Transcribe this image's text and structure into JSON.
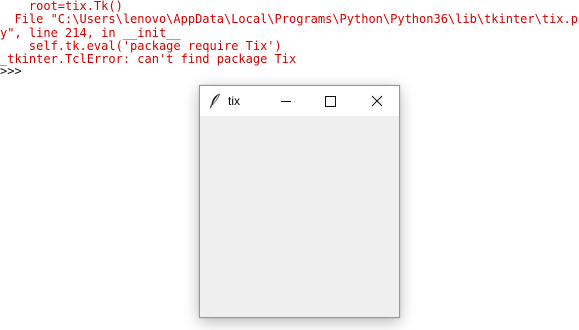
{
  "console": {
    "lines": [
      "    root=tix.Tk()",
      "  File \"C:\\Users\\lenovo\\AppData\\Local\\Programs\\Python\\Python36\\lib\\tkinter\\tix.p",
      "y\", line 214, in __init__",
      "    self.tk.eval('package require Tix')",
      "_tkinter.TclError: can't find package Tix"
    ],
    "prompt": ">>> ",
    "error_color": "#d40000"
  },
  "window": {
    "title": "tix",
    "icon": "feather-icon",
    "controls": [
      "minimize-icon",
      "maximize-icon",
      "close-icon"
    ]
  }
}
